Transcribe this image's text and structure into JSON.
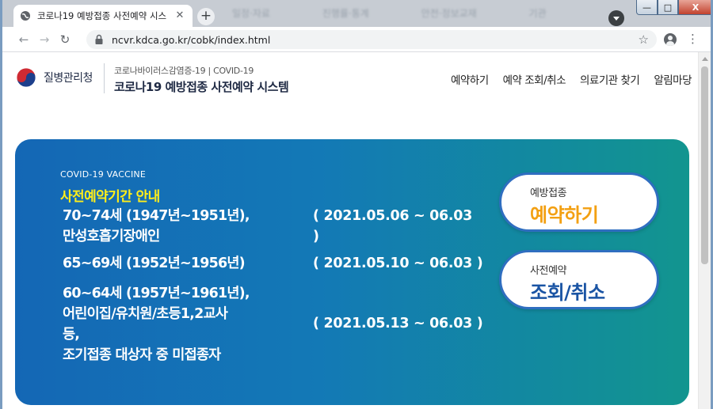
{
  "browser": {
    "tab_title": "코로나19 예방접종 사전예약 시스",
    "tab_close": "✕",
    "new_tab": "+",
    "background_tabs": [
      "일정·자료",
      "진행률·통계",
      "안전·정보교재",
      "기관 "
    ],
    "url": "ncvr.kdca.go.kr/cobk/index.html",
    "window_controls": {
      "minimize": "—",
      "maximize": "□",
      "close": "X"
    }
  },
  "header": {
    "org_name": "질병관리청",
    "subtitle": "코로나바이러스감염증-19 | COVID-19",
    "system_title": "코로나19 예방접종 사전예약 시스템",
    "nav": [
      "예약하기",
      "예약 조회/취소",
      "의료기관 찾기",
      "알림마당"
    ]
  },
  "banner": {
    "eyebrow": "COVID-19 VACCINE",
    "title": "사전예약기간 안내",
    "groups": [
      {
        "lines": [
          "70~74세 (1947년~1951년),",
          "만성호흡기장애인"
        ],
        "period_lines": [
          "( 2021.05.06 ~ 06.03",
          ")"
        ]
      },
      {
        "lines": [
          "65~69세 (1952년~1956년)"
        ],
        "period_lines": [
          "( 2021.05.10 ~ 06.03 )"
        ]
      },
      {
        "lines": [
          "60~64세 (1957년~1961년),",
          "어린이집/유치원/초등1,2교사",
          "등,",
          "조기접종 대상자 중 미접종자"
        ],
        "period_lines": [
          "( 2021.05.13 ~ 06.03 )"
        ]
      }
    ],
    "reserve_button": {
      "small": "예방접종",
      "big": "예약하기"
    },
    "lookup_button": {
      "small": "사전예약",
      "big": "조회/취소"
    }
  },
  "colors": {
    "banner_start": "#1467b5",
    "banner_end": "#12958f",
    "title_yellow": "#ffee1a",
    "reserve_orange": "#f3a012",
    "lookup_blue": "#1a54a4"
  }
}
